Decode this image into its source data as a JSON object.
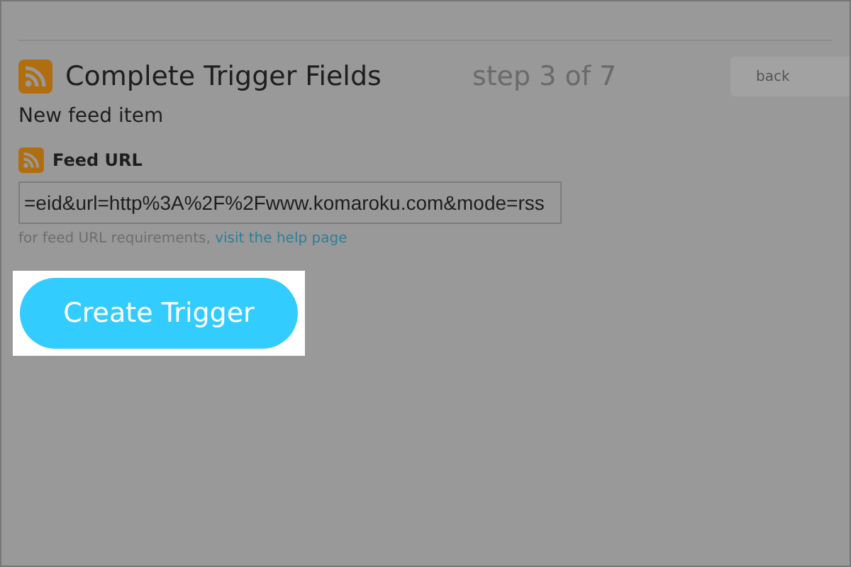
{
  "header": {
    "title": "Complete Trigger Fields",
    "step": "step 3 of 7",
    "back_button": "back"
  },
  "subtitle": "New feed item",
  "field": {
    "label": "Feed URL",
    "value": "=eid&url=http%3A%2F%2Fwww.komaroku.com&mode=rss",
    "help_text": "for feed URL requirements,",
    "help_link": "visit the help page"
  },
  "button": "Create Trigger"
}
